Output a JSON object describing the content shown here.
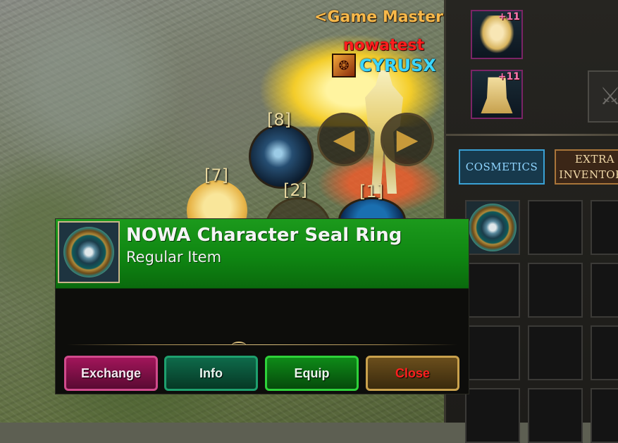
{
  "player": {
    "title": "<Game Master>",
    "name": "nowatest",
    "guild": "CYRUSX"
  },
  "skills": {
    "slot8_label": "[8]",
    "slot7_label": "[7]",
    "slot2_label": "[2]",
    "slot1_label": "[1]"
  },
  "equipment": {
    "gloves_plus": "+11",
    "boots_plus": "+11"
  },
  "inventory": {
    "tabs": [
      {
        "label": "COSMETICS",
        "active": true
      },
      {
        "label": "EXTRA INVENTORY",
        "active": false
      }
    ]
  },
  "tooltip": {
    "item_name": "NOWA Character Seal Ring",
    "item_type": "Regular Item",
    "rarity_color": "#12901a",
    "buttons": {
      "exchange": "Exchange",
      "info": "Info",
      "equip": "Equip",
      "close": "Close"
    }
  },
  "icons": {
    "item": "seal-ring-icon",
    "weapon_slot": "sword-icon",
    "guild_emblem": "dragon-emblem-icon"
  }
}
